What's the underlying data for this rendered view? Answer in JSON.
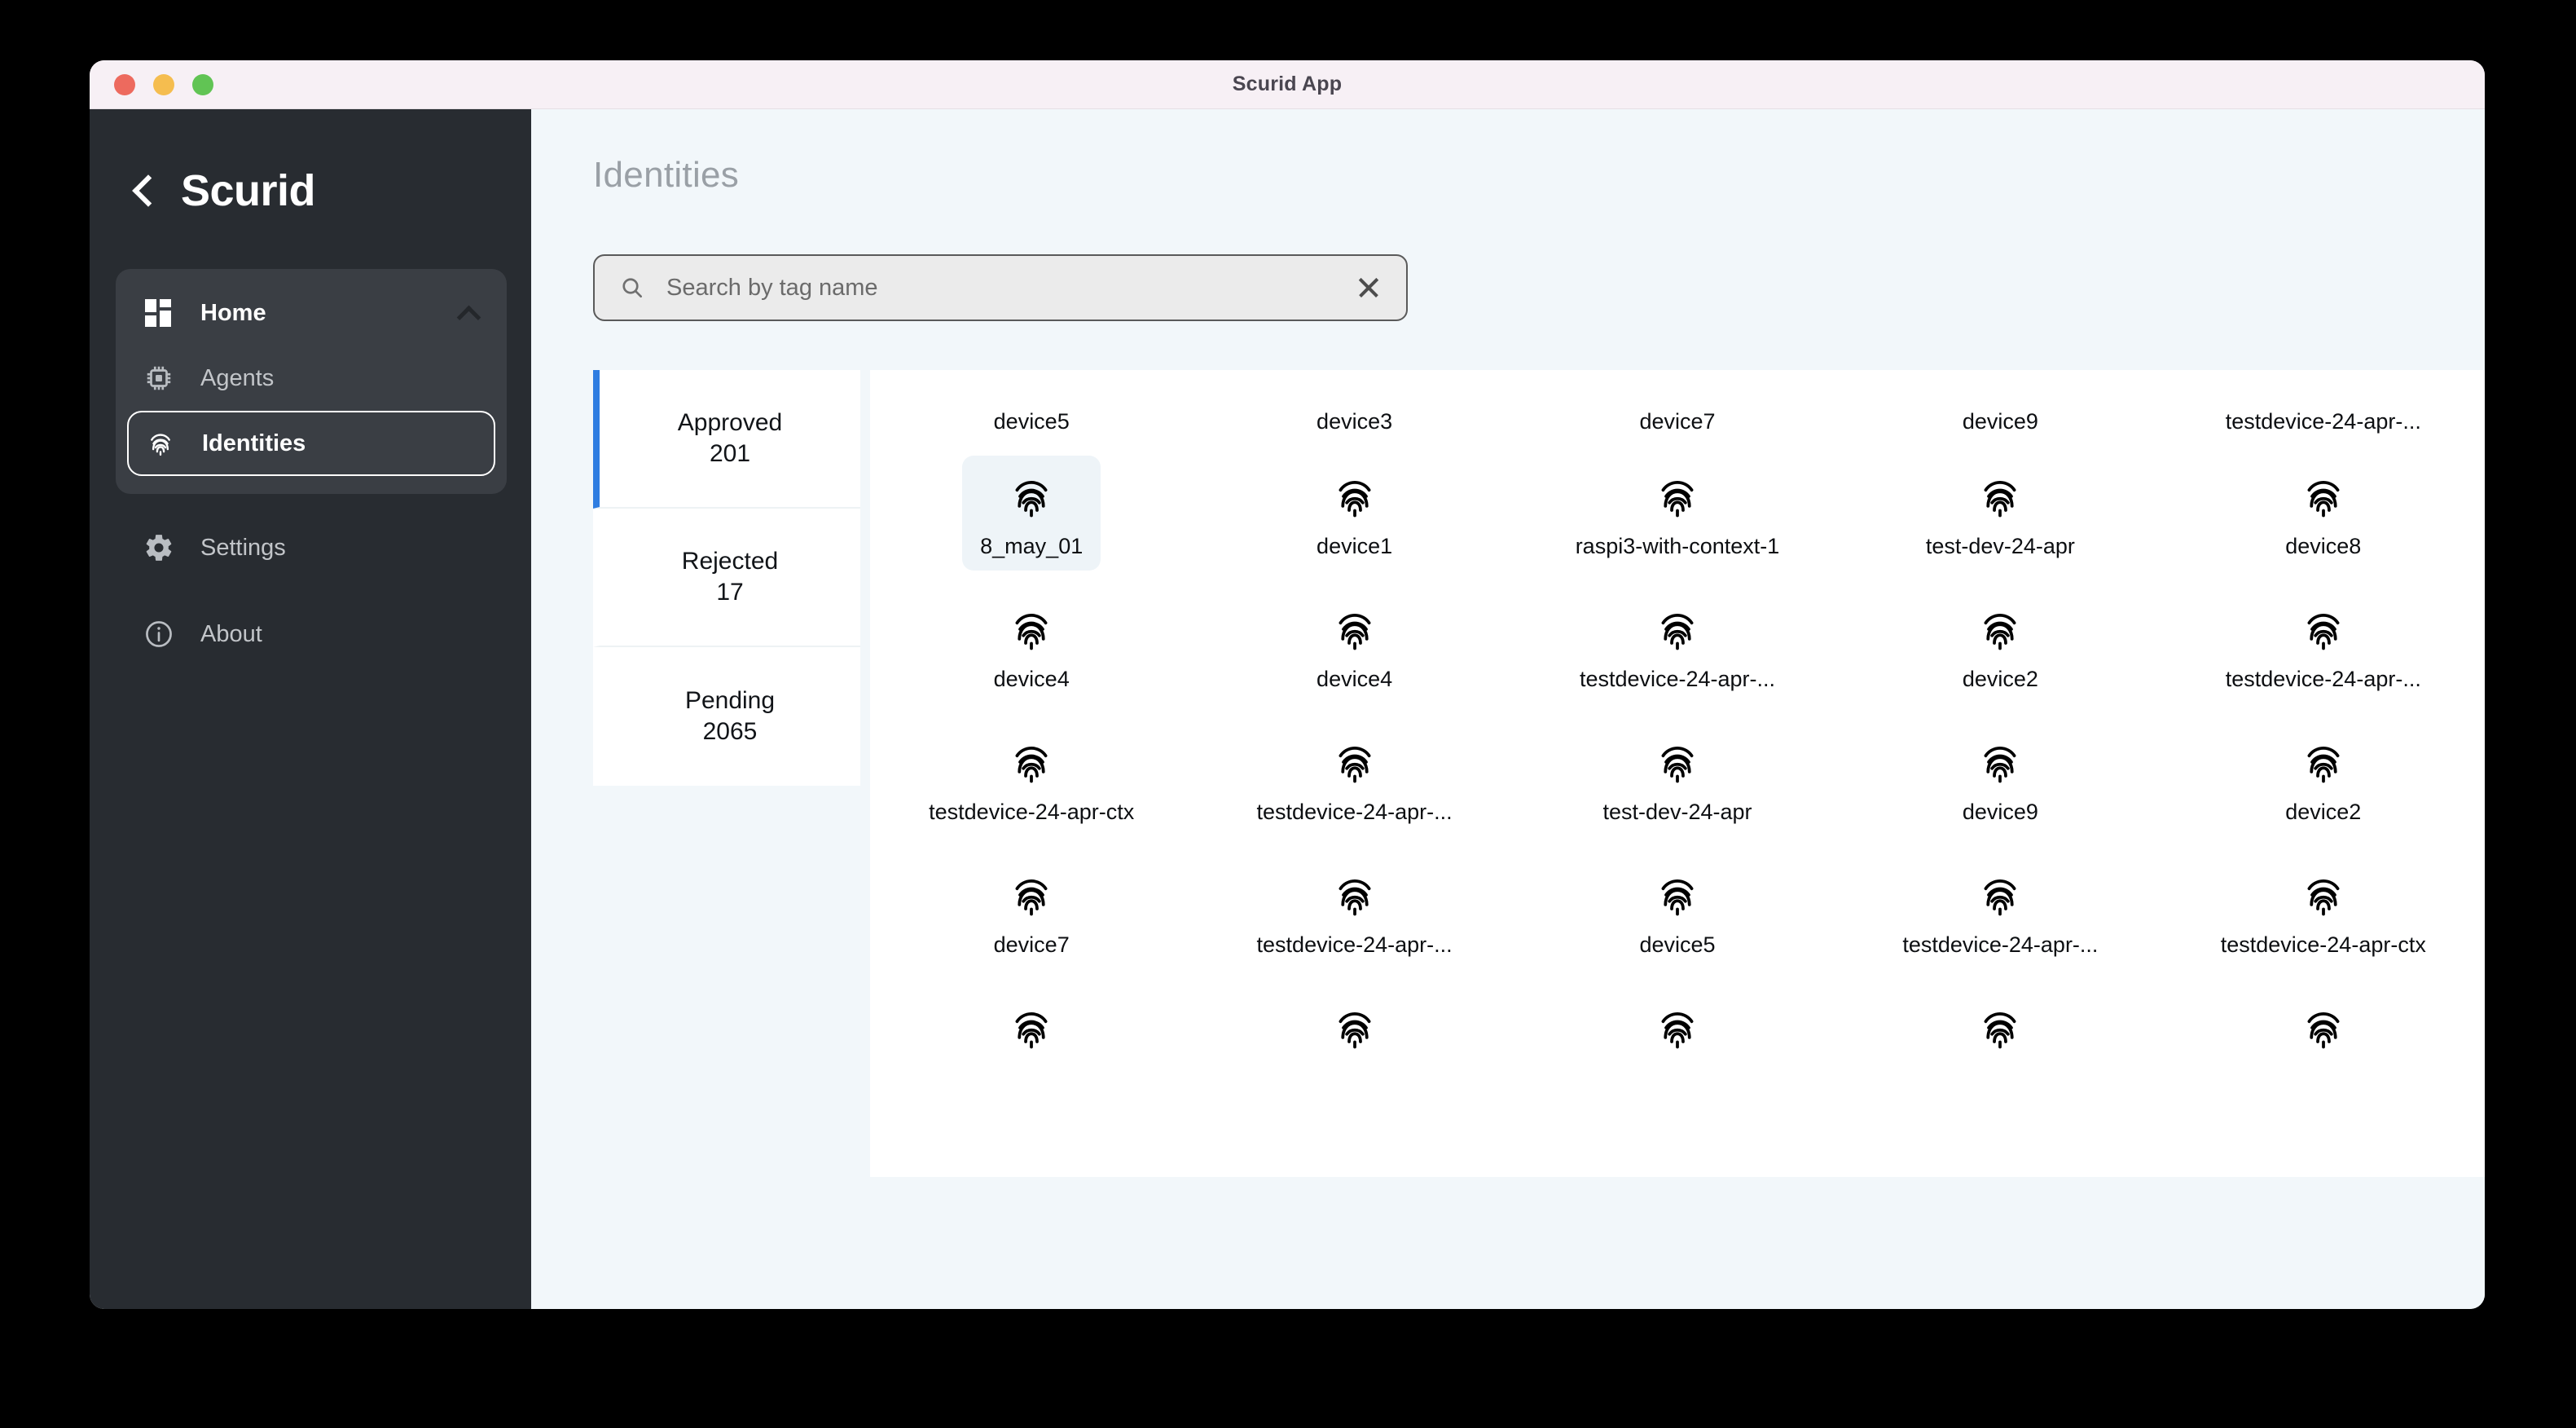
{
  "window": {
    "title": "Scurid App",
    "traffic_lights": [
      "close",
      "minimize",
      "maximize"
    ],
    "colors": {
      "close": "#ed6a5e",
      "minimize": "#f5bd4f",
      "maximize": "#61c454",
      "sidebar": "#282c31",
      "accent": "#2f7de1",
      "canvas": "#f2f7fa"
    }
  },
  "sidebar": {
    "back_icon": "chevron-left-icon",
    "brand": "Scurid",
    "group": {
      "label": "Home",
      "icon": "dashboard-grid-icon",
      "chevron": "chevron-up-icon",
      "items": [
        {
          "label": "Agents",
          "icon": "chip-icon",
          "selected": false
        },
        {
          "label": "Identities",
          "icon": "fingerprint-icon",
          "selected": true
        }
      ]
    },
    "items": [
      {
        "label": "Settings",
        "icon": "gear-icon"
      },
      {
        "label": "About",
        "icon": "info-icon"
      }
    ]
  },
  "main": {
    "page_title": "Identities",
    "search": {
      "placeholder": "Search by tag name",
      "value": "",
      "icon": "search-icon",
      "clear_icon": "close-icon"
    },
    "tabs": [
      {
        "label": "Approved",
        "count": "201",
        "active": true
      },
      {
        "label": "Rejected",
        "count": "17",
        "active": false
      },
      {
        "label": "Pending",
        "count": "2065",
        "active": false
      }
    ],
    "grid": {
      "icon": "fingerprint-icon",
      "columns": 5,
      "top_row_labels": [
        "device5",
        "device3",
        "device7",
        "device9",
        "testdevice-24-apr-..."
      ],
      "rows": [
        [
          {
            "name": "8_may_01",
            "selected": true
          },
          {
            "name": "device1",
            "selected": false
          },
          {
            "name": "raspi3-with-context-1",
            "selected": false
          },
          {
            "name": "test-dev-24-apr",
            "selected": false
          },
          {
            "name": "device8",
            "selected": false
          }
        ],
        [
          {
            "name": "device4",
            "selected": false
          },
          {
            "name": "device4",
            "selected": false
          },
          {
            "name": "testdevice-24-apr-...",
            "selected": false
          },
          {
            "name": "device2",
            "selected": false
          },
          {
            "name": "testdevice-24-apr-...",
            "selected": false
          }
        ],
        [
          {
            "name": "testdevice-24-apr-ctx",
            "selected": false
          },
          {
            "name": "testdevice-24-apr-...",
            "selected": false
          },
          {
            "name": "test-dev-24-apr",
            "selected": false
          },
          {
            "name": "device9",
            "selected": false
          },
          {
            "name": "device2",
            "selected": false
          }
        ],
        [
          {
            "name": "device7",
            "selected": false
          },
          {
            "name": "testdevice-24-apr-...",
            "selected": false
          },
          {
            "name": "device5",
            "selected": false
          },
          {
            "name": "testdevice-24-apr-...",
            "selected": false
          },
          {
            "name": "testdevice-24-apr-ctx",
            "selected": false
          }
        ],
        [
          {
            "name": "",
            "selected": false
          },
          {
            "name": "",
            "selected": false
          },
          {
            "name": "",
            "selected": false
          },
          {
            "name": "",
            "selected": false
          },
          {
            "name": "",
            "selected": false
          }
        ]
      ]
    }
  }
}
